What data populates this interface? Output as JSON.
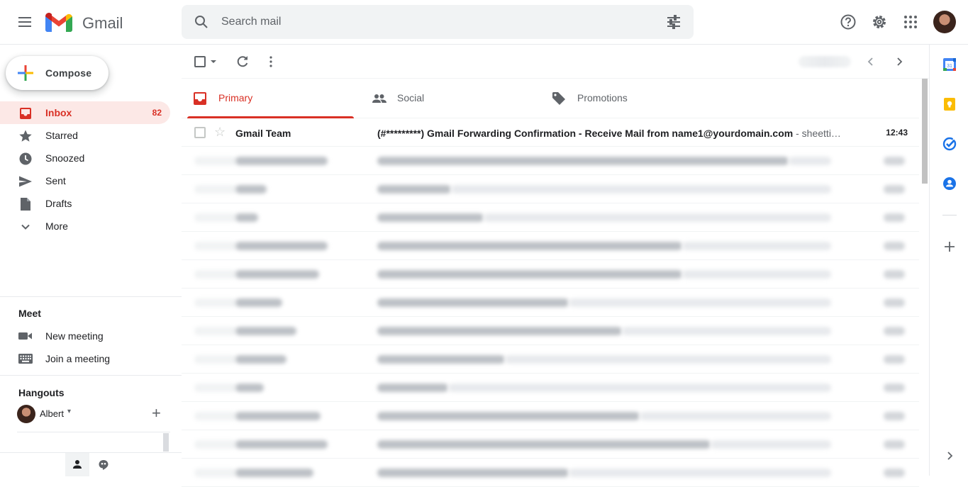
{
  "header": {
    "app_name": "Gmail",
    "search_placeholder": "Search mail"
  },
  "compose": {
    "label": "Compose"
  },
  "nav": {
    "items": [
      {
        "label": "Inbox",
        "count": "82",
        "icon": "inbox-icon",
        "active": true
      },
      {
        "label": "Starred",
        "icon": "star-icon"
      },
      {
        "label": "Snoozed",
        "icon": "clock-icon"
      },
      {
        "label": "Sent",
        "icon": "send-icon"
      },
      {
        "label": "Drafts",
        "icon": "draft-icon"
      },
      {
        "label": "More",
        "icon": "chevron-down-icon"
      }
    ]
  },
  "meet": {
    "title": "Meet",
    "items": [
      {
        "label": "New meeting",
        "icon": "video-icon"
      },
      {
        "label": "Join a meeting",
        "icon": "keyboard-icon"
      }
    ]
  },
  "hangouts": {
    "title": "Hangouts",
    "user": "Albert"
  },
  "tabs": [
    {
      "label": "Primary",
      "icon": "inbox-icon",
      "active": true
    },
    {
      "label": "Social",
      "icon": "people-icon"
    },
    {
      "label": "Promotions",
      "icon": "tag-icon"
    }
  ],
  "emails": [
    {
      "sender": "Gmail Team",
      "subject": "(#*********) Gmail Forwarding Confirmation - Receive Mail from name1@yourdomain.com",
      "snippet": " - sheetti…",
      "time": "12:43",
      "unread": true
    }
  ],
  "colors": {
    "accent": "#d93025",
    "active_bg": "#fce8e6",
    "text": "#202124",
    "muted": "#5f6368"
  }
}
